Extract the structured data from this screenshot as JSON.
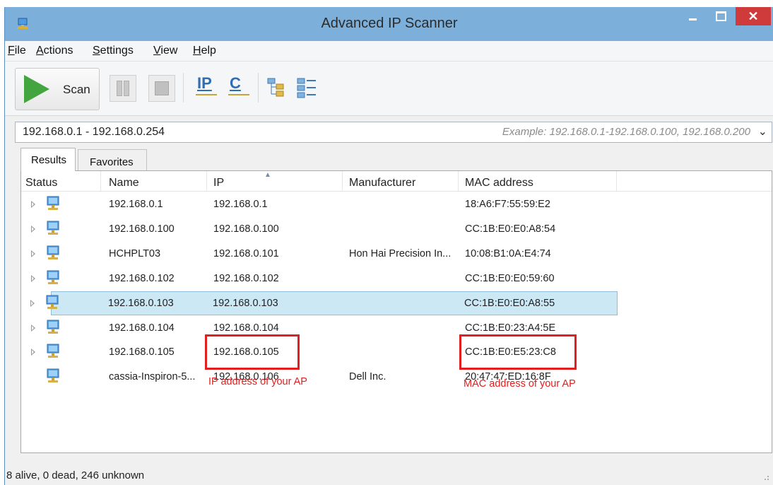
{
  "window": {
    "title": "Advanced IP Scanner"
  },
  "menu": [
    "File",
    "Actions",
    "Settings",
    "View",
    "Help"
  ],
  "toolbar": {
    "scan_label": "Scan",
    "ip_label": "IP",
    "c_label": "C"
  },
  "range": {
    "value": "192.168.0.1 - 192.168.0.254",
    "hint": "Example: 192.168.0.1-192.168.0.100, 192.168.0.200",
    "arrow": "⌄"
  },
  "tabs": [
    "Results",
    "Favorites"
  ],
  "columns": [
    "Status",
    "Name",
    "IP",
    "Manufacturer",
    "MAC address"
  ],
  "rows": [
    {
      "name": "192.168.0.1",
      "ip": "192.168.0.1",
      "manufacturer": "",
      "mac": "18:A6:F7:55:59:E2",
      "expandable": true
    },
    {
      "name": "192.168.0.100",
      "ip": "192.168.0.100",
      "manufacturer": "",
      "mac": "CC:1B:E0:E0:A8:54",
      "expandable": true
    },
    {
      "name": "HCHPLT03",
      "ip": "192.168.0.101",
      "manufacturer": "Hon Hai Precision In...",
      "mac": "10:08:B1:0A:E4:74",
      "expandable": true
    },
    {
      "name": "192.168.0.102",
      "ip": "192.168.0.102",
      "manufacturer": "",
      "mac": "CC:1B:E0:E0:59:60",
      "expandable": true
    },
    {
      "name": "192.168.0.103",
      "ip": "192.168.0.103",
      "manufacturer": "",
      "mac": "CC:1B:E0:E0:A8:55",
      "expandable": true,
      "selected": true
    },
    {
      "name": "192.168.0.104",
      "ip": "192.168.0.104",
      "manufacturer": "",
      "mac": "CC:1B:E0:23:A4:5E",
      "expandable": true
    },
    {
      "name": "192.168.0.105",
      "ip": "192.168.0.105",
      "manufacturer": "",
      "mac": "CC:1B:E0:E5:23:C8",
      "expandable": true
    },
    {
      "name": "cassia-Inspiron-5...",
      "ip": "192.168.0.106",
      "manufacturer": "Dell Inc.",
      "mac": "20:47:47:ED:16:8F",
      "expandable": false
    }
  ],
  "annotations": {
    "ip_note": "IP address of your AP",
    "mac_note": "MAC address of your AP",
    "color": "#e02020"
  },
  "status": {
    "text": "8 alive, 0 dead, 246 unknown"
  },
  "colors": {
    "titlebar": "#7cb0da",
    "close": "#cf3b3b",
    "selected_row": "#cce8f5",
    "scan_play": "#43a53f"
  }
}
